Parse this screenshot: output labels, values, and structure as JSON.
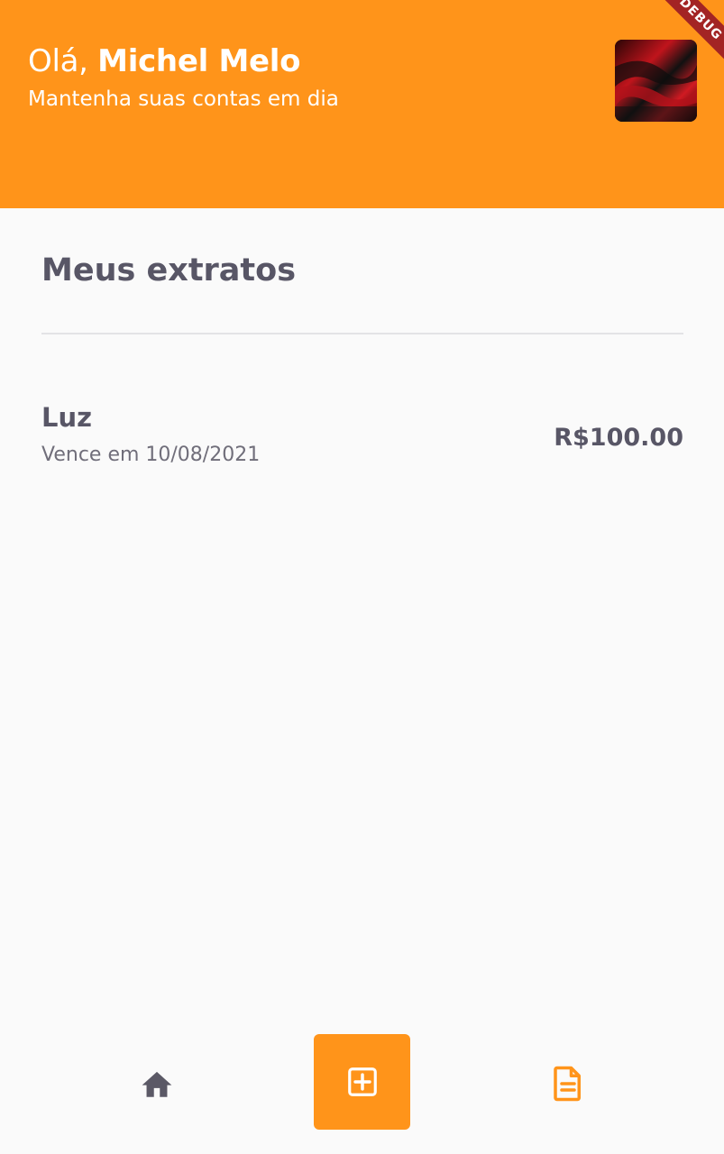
{
  "header": {
    "greeting_prefix": "Olá, ",
    "user_name": "Michel Melo",
    "subtitle": "Mantenha suas contas em dia",
    "debug_banner": "DEBUG",
    "background_color": "#FF941A"
  },
  "main": {
    "title": "Meus extratos",
    "bills": [
      {
        "name": "Luz",
        "due_text": "Vence em 10/08/2021",
        "value": "R$100.00"
      }
    ]
  },
  "bottom_nav": {
    "items": [
      {
        "icon": "home-icon",
        "color": "#5B5966"
      },
      {
        "icon": "add-box-icon",
        "color": "#FFFFFF",
        "background": "#FF941A"
      },
      {
        "icon": "description-icon",
        "color": "#FF941A"
      }
    ]
  }
}
